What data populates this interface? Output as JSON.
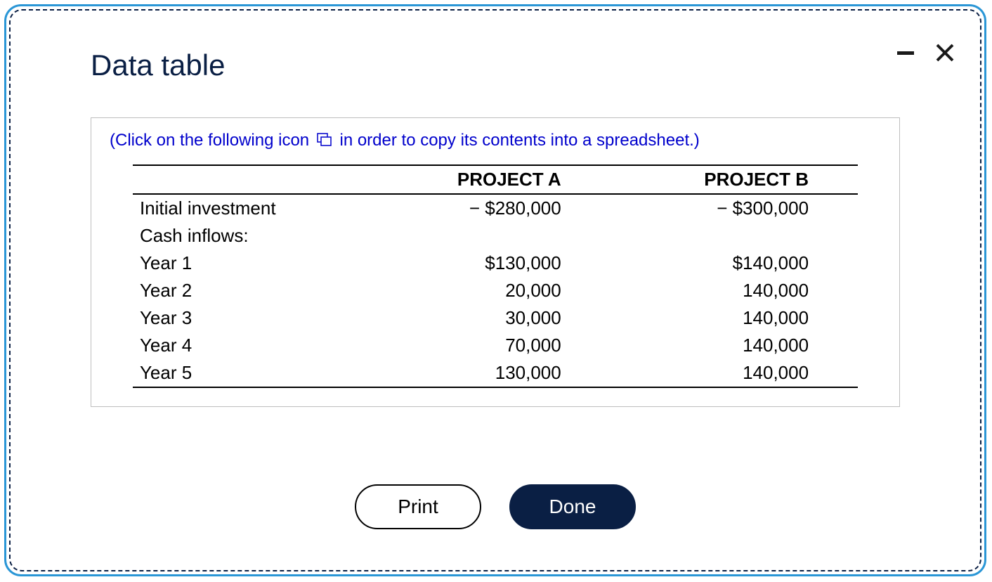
{
  "title": "Data table",
  "hint_before": "(Click on the following icon",
  "hint_after": "in order to copy its contents into a spreadsheet.)",
  "columns": {
    "c0": "",
    "c1": "PROJECT A",
    "c2": "PROJECT B"
  },
  "rows": {
    "r0": {
      "label": "Initial investment",
      "a": "− $280,000",
      "b": "− $300,000"
    },
    "r1": {
      "label": "Cash inflows:",
      "a": "",
      "b": ""
    },
    "r2": {
      "label": "Year 1",
      "a": "$130,000",
      "b": "$140,000"
    },
    "r3": {
      "label": "Year 2",
      "a": "20,000",
      "b": "140,000"
    },
    "r4": {
      "label": "Year 3",
      "a": "30,000",
      "b": "140,000"
    },
    "r5": {
      "label": "Year 4",
      "a": "70,000",
      "b": "140,000"
    },
    "r6": {
      "label": "Year 5",
      "a": "130,000",
      "b": "140,000"
    }
  },
  "buttons": {
    "print": "Print",
    "done": "Done"
  },
  "chart_data": {
    "type": "table",
    "columns": [
      "",
      "PROJECT A",
      "PROJECT B"
    ],
    "rows": [
      [
        "Initial investment",
        -280000,
        -300000
      ],
      [
        "Cash inflows:",
        null,
        null
      ],
      [
        "Year 1",
        130000,
        140000
      ],
      [
        "Year 2",
        20000,
        140000
      ],
      [
        "Year 3",
        30000,
        140000
      ],
      [
        "Year 4",
        70000,
        140000
      ],
      [
        "Year 5",
        130000,
        140000
      ]
    ]
  }
}
